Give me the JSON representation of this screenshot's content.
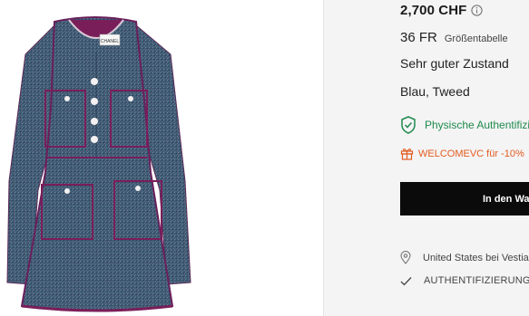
{
  "product": {
    "image_alt_icon": "dress-image",
    "brand_label": "CHANEL"
  },
  "details": {
    "price": "2,700 CHF",
    "size": "36 FR",
    "size_guide": "Größentabelle",
    "condition": "Sehr guter Zustand",
    "material": "Blau, Tweed",
    "authenticity_badge": "Physische Authentifizierung",
    "promo": "WELCOMEVC für -10%",
    "cart_button": "In den Warenkorb",
    "shipping": "United States bei Vestiaire Collective",
    "authentication_service": "AUTHENTIFIZIERUNG"
  },
  "colors": {
    "green": "#1f8a4c",
    "orange": "#e25b1f",
    "black": "#0b0b0b"
  }
}
